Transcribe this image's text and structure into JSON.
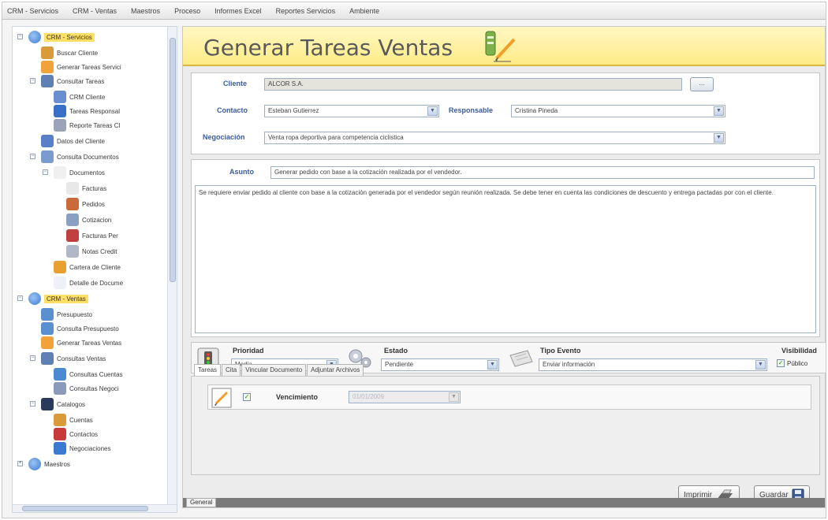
{
  "menu": [
    "CRM - Servicios",
    "CRM - Ventas",
    "Maestros",
    "Proceso",
    "Informes Excel",
    "Reportes Servicios",
    "Ambiente"
  ],
  "tree": [
    {
      "label": "CRM - Servicios",
      "icon": "crm-services-icon",
      "selected": true
    },
    {
      "label": "Buscar Cliente",
      "icon": "search-client-icon"
    },
    {
      "label": "Generar Tareas Servici",
      "icon": "pencil-icon"
    },
    {
      "label": "Consultar Tareas",
      "icon": "tasks-icon"
    },
    {
      "label": "CRM Cliente",
      "icon": "client-icon"
    },
    {
      "label": "Tareas Responsal",
      "icon": "people-icon"
    },
    {
      "label": "Reporte Tareas Cl",
      "icon": "report-icon"
    },
    {
      "label": "Datos del Cliente",
      "icon": "client-data-icon"
    },
    {
      "label": "Consulta Documentos",
      "icon": "documents-icon"
    },
    {
      "label": "Documentos",
      "icon": "folder-icon"
    },
    {
      "label": "Facturas",
      "icon": "invoice-icon"
    },
    {
      "label": "Pedidos",
      "icon": "order-icon"
    },
    {
      "label": "Cotizacion",
      "icon": "quote-icon"
    },
    {
      "label": "Facturas Per",
      "icon": "invoice-icon"
    },
    {
      "label": "Notas Credit",
      "icon": "credit-note-icon"
    },
    {
      "label": "Cartera de Cliente",
      "icon": "wallet-icon"
    },
    {
      "label": "Detalle de Docume",
      "icon": "doc-detail-icon"
    },
    {
      "label": "CRM - Ventas",
      "icon": "crm-sales-icon",
      "selected": true
    },
    {
      "label": "Presupuesto",
      "icon": "budget-icon"
    },
    {
      "label": "Consulta Presupuesto",
      "icon": "budget-query-icon"
    },
    {
      "label": "Generar Tareas Ventas",
      "icon": "pencil-icon"
    },
    {
      "label": "Consultas Ventas",
      "icon": "sales-query-icon"
    },
    {
      "label": "Consultas Cuentas",
      "icon": "accounts-icon"
    },
    {
      "label": "Consultas Negoci",
      "icon": "negotiations-icon"
    },
    {
      "label": "Catalogos",
      "icon": "catalog-icon"
    },
    {
      "label": "Cuentas",
      "icon": "people-icon"
    },
    {
      "label": "Contactos",
      "icon": "contacts-icon"
    },
    {
      "label": "Negociaciones",
      "icon": "handshake-icon"
    },
    {
      "label": "Maestros",
      "icon": "masters-icon"
    }
  ],
  "page": {
    "title": "Generar Tareas Ventas"
  },
  "form": {
    "cliente_label": "Cliente",
    "cliente_value": "ALCOR S.A.",
    "browse_label": "...",
    "contacto_label": "Contacto",
    "contacto_value": "Esteban Gutierrez",
    "responsable_label": "Responsable",
    "responsable_value": "Cristina Pineda",
    "negociacion_label": "Negociación",
    "negociacion_value": "Venta ropa deportiva para competencia ciclistica",
    "asunto_label": "Asunto",
    "asunto_value": "Generar pedido con base a la cotización realizada por el vendedor.",
    "descripcion": "Se requiere enviar pedido al cliente con base a la cotización generada por el vendedor según reunión realizada. Se debe tener en cuenta las condiciones de descuento y entrega pactadas por con el cliente."
  },
  "options": {
    "prioridad_label": "Prioridad",
    "prioridad_value": "Media",
    "estado_label": "Estado",
    "estado_value": "Pendiente",
    "tipo_label": "Tipo Evento",
    "tipo_value": "Enviar información",
    "visibilidad_label": "Visibilidad",
    "publico_label": "Público",
    "publico_checked": true
  },
  "tabs": [
    "Tareas",
    "Cita",
    "Vincular Documento",
    "Adjuntar Archivos"
  ],
  "tarea": {
    "vencimiento_label": "Vencimiento",
    "vencimiento_value": "01/01/2009",
    "checked": true
  },
  "buttons": {
    "imprimir": "Imprimir",
    "guardar": "Guardar"
  },
  "bottom_tab": "General",
  "colors": {
    "title_bar": "#ffec86",
    "label_blue": "#3b5b9a",
    "selection": "#ffe066"
  }
}
